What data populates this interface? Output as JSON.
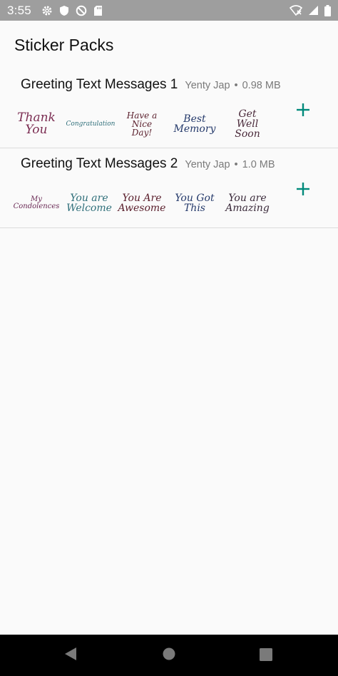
{
  "status_bar": {
    "time": "3:55",
    "icons_left": [
      "gear-icon",
      "shield-icon",
      "do-not-disturb-icon",
      "sd-card-icon"
    ],
    "icons_right": [
      "wifi-off-icon",
      "signal-icon",
      "battery-icon"
    ]
  },
  "page": {
    "title": "Sticker Packs"
  },
  "colors": {
    "accent": "#00897b",
    "status_bar": "#9e9e9e",
    "background": "#fafafa"
  },
  "packs": [
    {
      "name": "Greeting Text Messages 1",
      "publisher": "Yenty Jap",
      "separator": "•",
      "size": "0.98 MB",
      "stickers": [
        {
          "text": "Thank\nYou",
          "color": "#7b2d52"
        },
        {
          "text": "Congratulation",
          "color": "#2f6f7a"
        },
        {
          "text": "Have a\nNice Day!",
          "color": "#5a1f2c"
        },
        {
          "text": "Best\nMemory",
          "color": "#253a6b"
        },
        {
          "text": "Get Well\nSoon",
          "color": "#4a2a3a"
        }
      ]
    },
    {
      "name": "Greeting Text Messages 2",
      "publisher": "Yenty Jap",
      "separator": "•",
      "size": "1.0 MB",
      "stickers": [
        {
          "text": "My\nCondolences",
          "color": "#6a2a55"
        },
        {
          "text": "You are\nWelcome",
          "color": "#2f6f7a"
        },
        {
          "text": "You Are\nAwesome",
          "color": "#5a1f2c"
        },
        {
          "text": "You Got\nThis",
          "color": "#253a6b"
        },
        {
          "text": "You are\nAmazing",
          "color": "#3a2a3a"
        }
      ]
    }
  ],
  "nav_bar": {
    "buttons": [
      "back-icon",
      "home-icon",
      "recents-icon"
    ]
  }
}
